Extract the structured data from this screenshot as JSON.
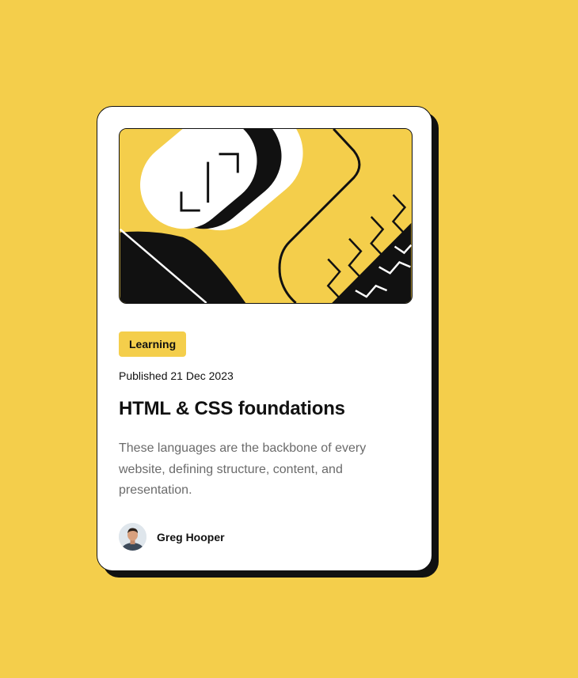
{
  "card": {
    "tag": "Learning",
    "published": "Published 21 Dec 2023",
    "title": "HTML & CSS foundations",
    "description": "These languages are the backbone of every website, defining structure, content, and presentation.",
    "author": {
      "name": "Greg Hooper",
      "avatar_icon": "person-avatar"
    },
    "illustration_icon": "abstract-geometric-illustration"
  },
  "colors": {
    "background": "#F4CE4B",
    "card": "#FFFFFF",
    "ink": "#111111",
    "muted_text": "#6B6B6B"
  }
}
